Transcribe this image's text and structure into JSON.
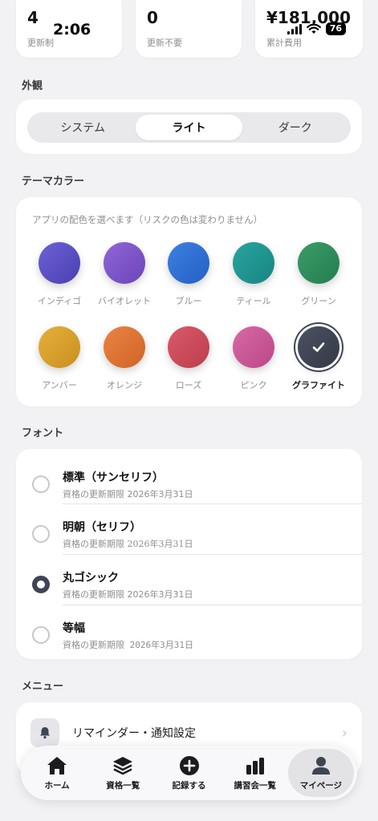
{
  "status_bar": {
    "time": "2:06",
    "battery": "76"
  },
  "stats": [
    {
      "value": "4",
      "label": "更新制"
    },
    {
      "value": "0",
      "label": "更新不要"
    },
    {
      "value": "¥181,000",
      "label": "累計費用"
    }
  ],
  "appearance": {
    "title": "外観",
    "options": [
      "システム",
      "ライト",
      "ダーク"
    ],
    "selected": "ライト"
  },
  "theme": {
    "title": "テーマカラー",
    "hint": "アプリの配色を選べます（リスクの色は変わりません）",
    "colors": [
      {
        "name": "インディゴ",
        "color": "#5b4fc4"
      },
      {
        "name": "バイオレット",
        "color": "#7e55c8"
      },
      {
        "name": "ブルー",
        "color": "#2f6fd3"
      },
      {
        "name": "ティール",
        "color": "#1f9490"
      },
      {
        "name": "グリーン",
        "color": "#2e8d5c"
      },
      {
        "name": "アンバー",
        "color": "#d9a12c"
      },
      {
        "name": "オレンジ",
        "color": "#df7432"
      },
      {
        "name": "ローズ",
        "color": "#cf4b5b"
      },
      {
        "name": "ピンク",
        "color": "#cc5898"
      },
      {
        "name": "グラファイト",
        "color": "#3f4553"
      }
    ],
    "selected": "グラファイト"
  },
  "font": {
    "title": "フォント",
    "options": [
      {
        "name": "標準（サンセリフ）",
        "sample": "資格の更新期限 2026年3月31日"
      },
      {
        "name": "明朝（セリフ）",
        "sample": "資格の更新期限 2026年3月31日"
      },
      {
        "name": "丸ゴシック",
        "sample": "資格の更新期限 2026年3月31日"
      },
      {
        "name": "等幅",
        "sample": "資格の更新期限 2026年3月31日"
      }
    ],
    "selected": "丸ゴシック"
  },
  "menu": {
    "title": "メニュー",
    "items": [
      {
        "label": "リマインダー・通知設定",
        "icon": "bell-icon"
      }
    ]
  },
  "tabbar": [
    {
      "label": "ホーム",
      "icon": "home-icon"
    },
    {
      "label": "資格一覧",
      "icon": "layers-icon"
    },
    {
      "label": "記録する",
      "icon": "plus-circle-icon"
    },
    {
      "label": "講習会一覧",
      "icon": "bar-chart-icon"
    },
    {
      "label": "マイページ",
      "icon": "person-icon"
    }
  ],
  "tabbar_active": "マイページ"
}
